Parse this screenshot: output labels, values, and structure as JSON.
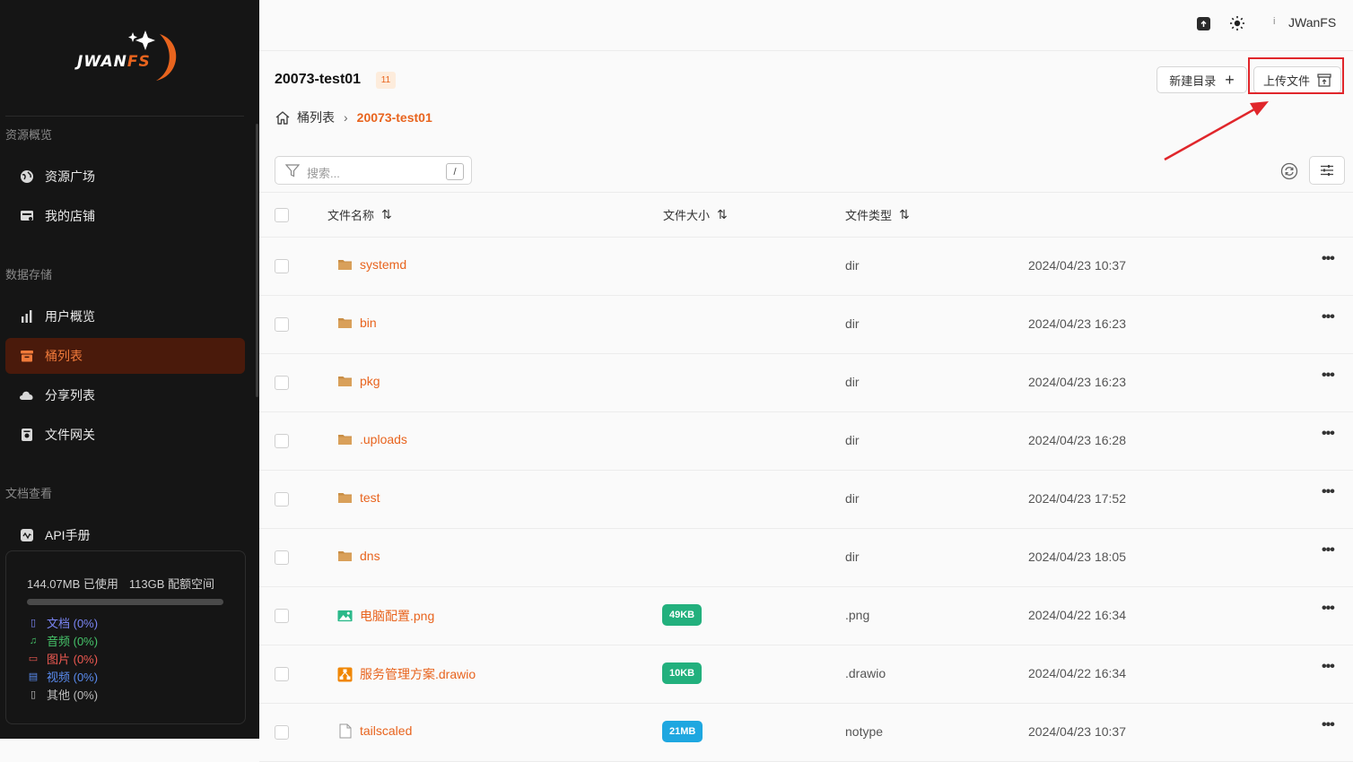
{
  "brand": {
    "logo_text_main": "JWAN",
    "logo_text_accent": "FS",
    "accent": "#e8641e"
  },
  "sidebar": {
    "sections": [
      {
        "title": "资源概览",
        "items": [
          {
            "label": "资源广场",
            "icon": "globe-icon"
          },
          {
            "label": "我的店铺",
            "icon": "store-icon"
          }
        ]
      },
      {
        "title": "数据存储",
        "items": [
          {
            "label": "用户概览",
            "icon": "bar-chart-icon"
          },
          {
            "label": "桶列表",
            "icon": "bucket-icon",
            "active": true
          },
          {
            "label": "分享列表",
            "icon": "cloud-share-icon"
          },
          {
            "label": "文件网关",
            "icon": "gateway-icon"
          }
        ]
      },
      {
        "title": "文档查看",
        "items": [
          {
            "label": "API手册",
            "icon": "api-manual-icon"
          }
        ]
      }
    ],
    "storage": {
      "used": "144.07MB 已使用",
      "quota": "113GB 配额空间",
      "used_fraction": 0.0,
      "breakdown": [
        {
          "label": "文档 (0%)",
          "icon": "document-icon",
          "color": "#7b86f5"
        },
        {
          "label": "音频 (0%)",
          "icon": "music-icon",
          "color": "#46c46a"
        },
        {
          "label": "图片 (0%)",
          "icon": "image-icon",
          "color": "#f05a52"
        },
        {
          "label": "视频 (0%)",
          "icon": "video-icon",
          "color": "#5a8cf0"
        },
        {
          "label": "其他 (0%)",
          "icon": "file-icon",
          "color": "#bdbdbd"
        }
      ]
    }
  },
  "topbar": {
    "user_initial": "i",
    "user_name": "JWanFS"
  },
  "header": {
    "bucket_name": "20073-test01",
    "count": "11",
    "breadcrumb": {
      "root": "桶列表",
      "current": "20073-test01"
    },
    "new_dir_label": "新建目录",
    "upload_label": "上传文件"
  },
  "search": {
    "placeholder": "搜索...",
    "shortcut": "/"
  },
  "table": {
    "columns": {
      "name": "文件名称",
      "size": "文件大小",
      "type": "文件类型"
    },
    "rows": [
      {
        "name": "systemd",
        "icon": "folder-icon",
        "size": "",
        "type": "dir",
        "date": "2024/04/23 10:37"
      },
      {
        "name": "bin",
        "icon": "folder-icon",
        "size": "",
        "type": "dir",
        "date": "2024/04/23 16:23"
      },
      {
        "name": "pkg",
        "icon": "folder-icon",
        "size": "",
        "type": "dir",
        "date": "2024/04/23 16:23"
      },
      {
        "name": ".uploads",
        "icon": "folder-icon",
        "size": "",
        "type": "dir",
        "date": "2024/04/23 16:28"
      },
      {
        "name": "test",
        "icon": "folder-icon",
        "size": "",
        "type": "dir",
        "date": "2024/04/23 17:52"
      },
      {
        "name": "dns",
        "icon": "folder-icon",
        "size": "",
        "type": "dir",
        "date": "2024/04/23 18:05"
      },
      {
        "name": "电脑配置.png",
        "icon": "image-file-icon",
        "size": "49KB",
        "size_color": "#22b07d",
        "type": ".png",
        "date": "2024/04/22 16:34"
      },
      {
        "name": "服务管理方案.drawio",
        "icon": "drawio-icon",
        "size": "10KB",
        "size_color": "#22b07d",
        "type": ".drawio",
        "date": "2024/04/22 16:34"
      },
      {
        "name": "tailscaled",
        "icon": "file-icon",
        "size": "21MB",
        "size_color": "#1ea7e0",
        "type": "notype",
        "date": "2024/04/23 10:37"
      }
    ]
  }
}
